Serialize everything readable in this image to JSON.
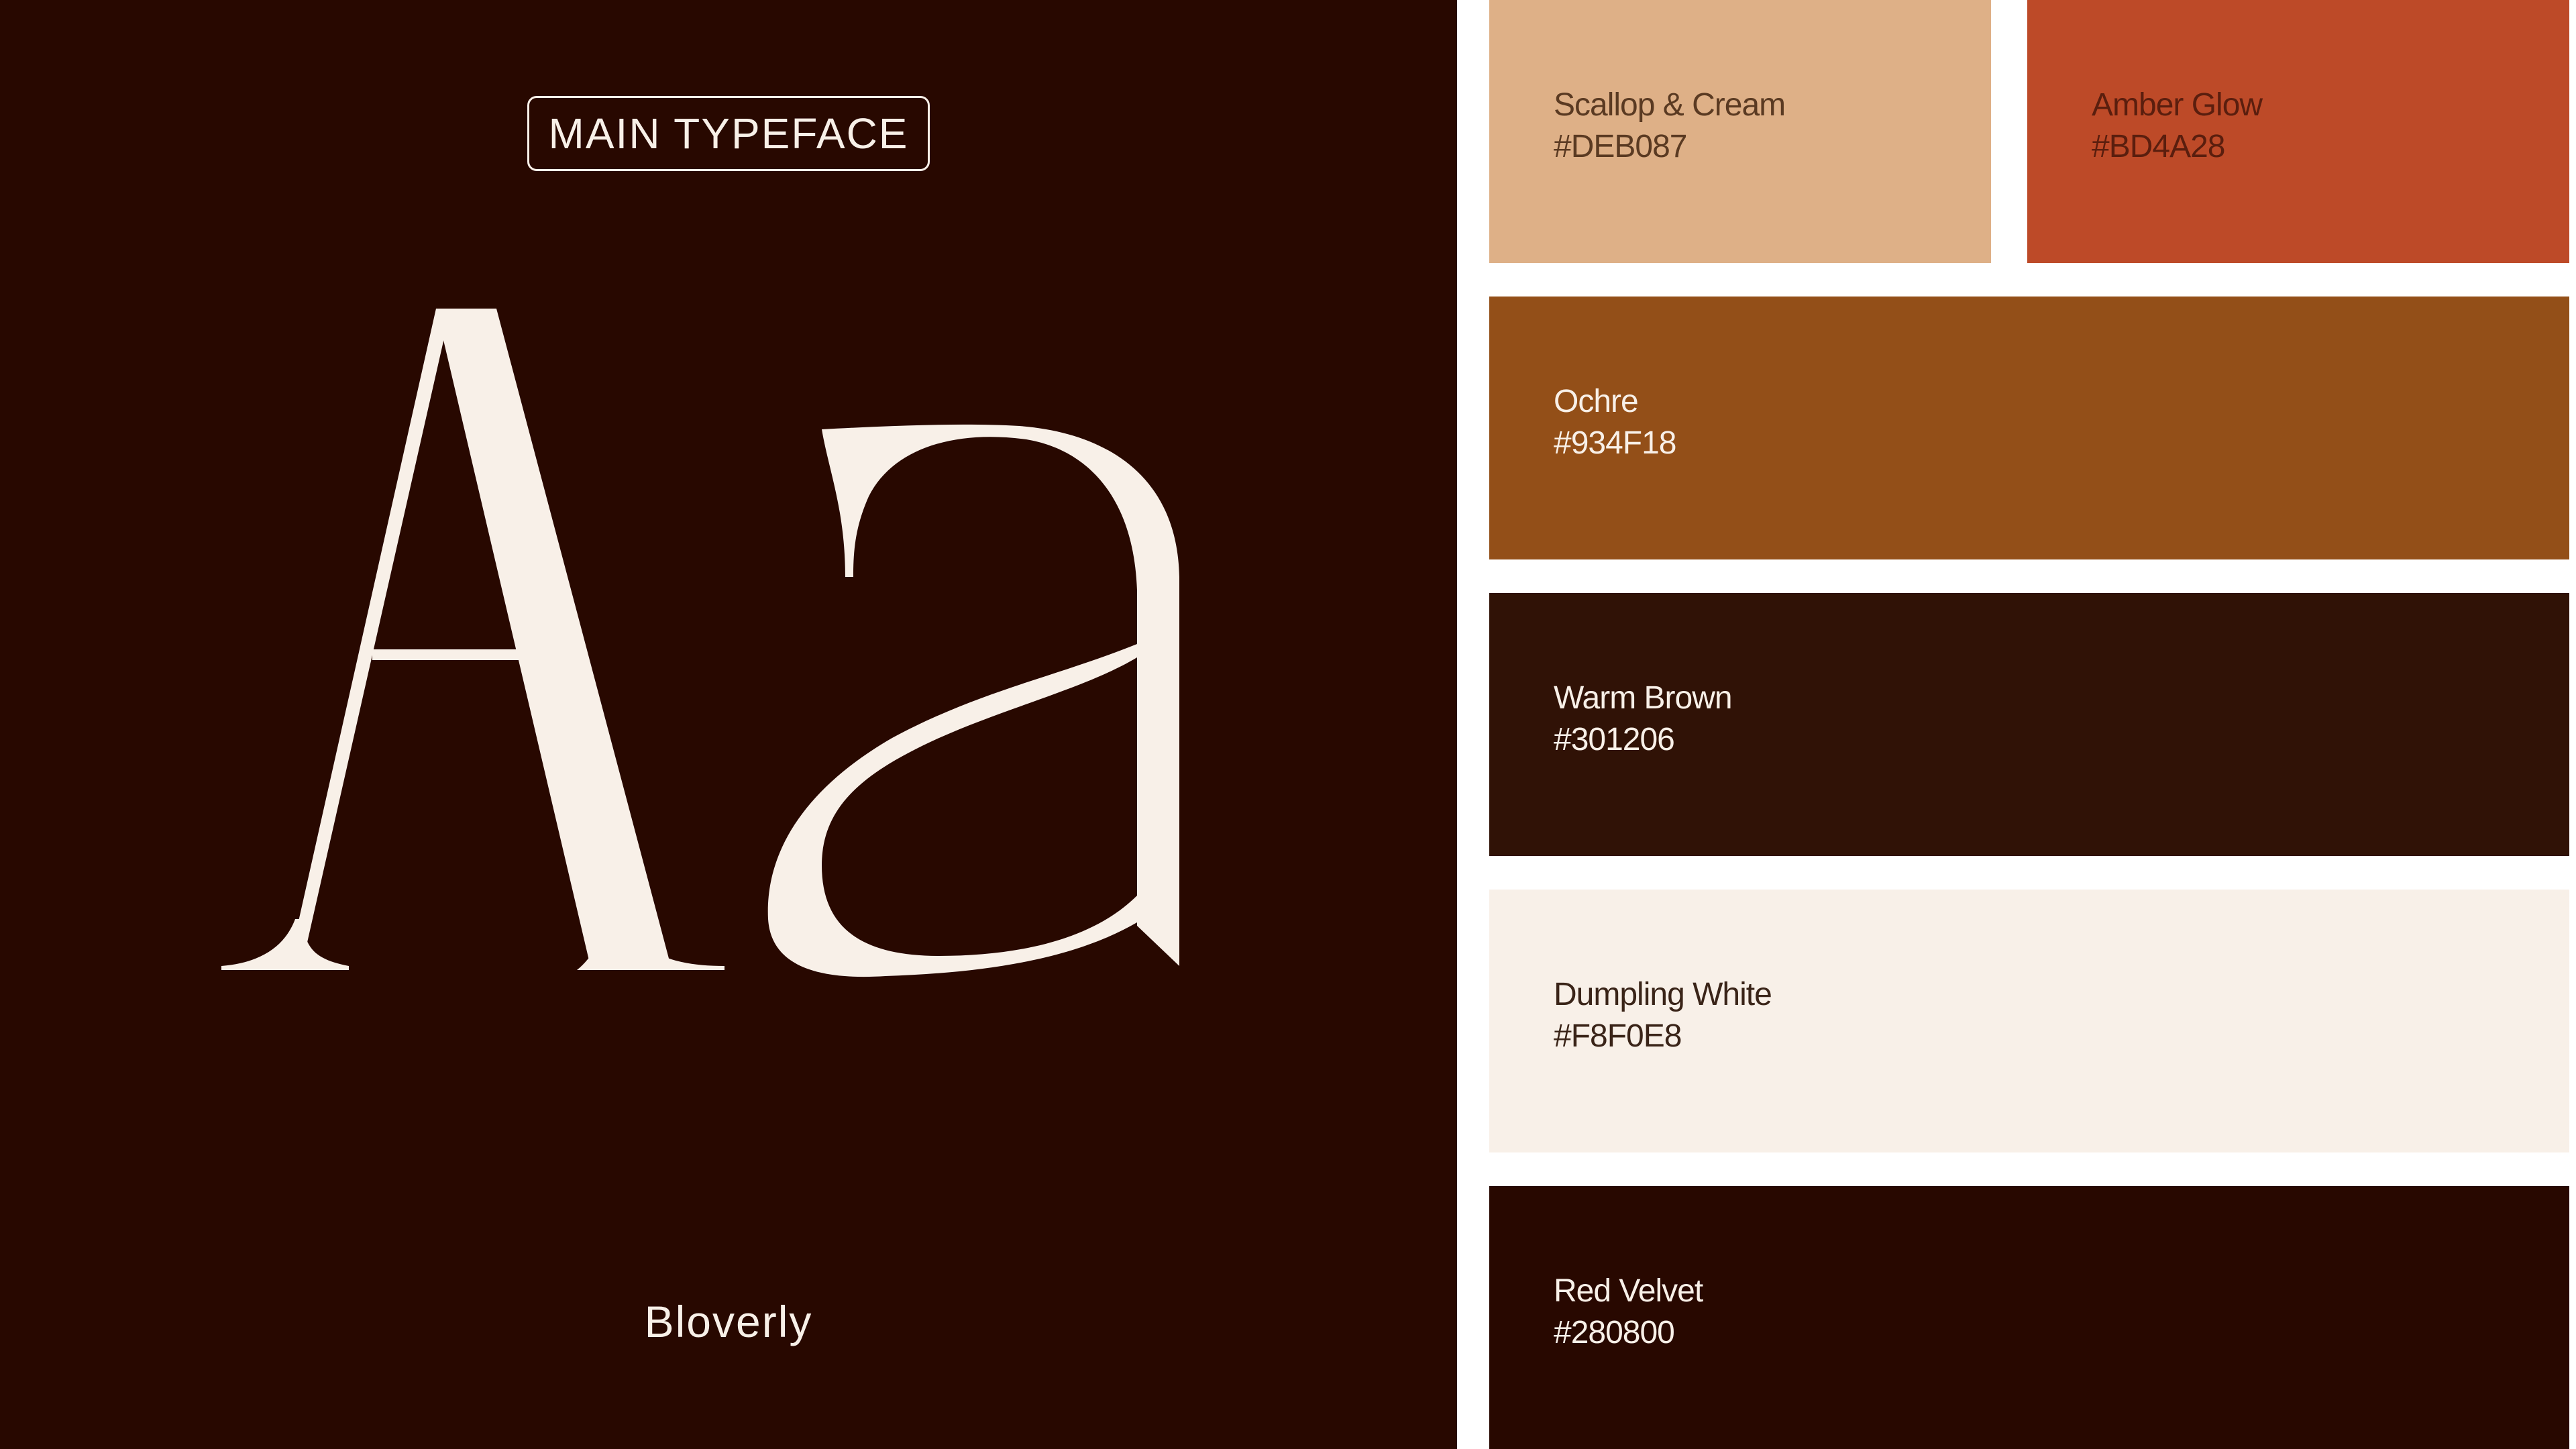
{
  "typeface": {
    "label": "MAIN TYPEFACE",
    "sample": "Aa",
    "name": "Bloverly"
  },
  "palette": [
    {
      "name": "Scallop & Cream",
      "hex": "#DEB087",
      "text_color": "#5A3A22"
    },
    {
      "name": "Amber Glow",
      "hex": "#BD4A28",
      "text_color": "#5A1E0E"
    },
    {
      "name": "Ochre",
      "hex": "#934F18",
      "text_color": "#F8F0E8"
    },
    {
      "name": "Warm Brown",
      "hex": "#301206",
      "text_color": "#F8F0E8"
    },
    {
      "name": "Dumpling White",
      "hex": "#F8F0E8",
      "text_color": "#3A2418"
    },
    {
      "name": "Red Velvet",
      "hex": "#280800",
      "text_color": "#F8F0E8"
    }
  ]
}
